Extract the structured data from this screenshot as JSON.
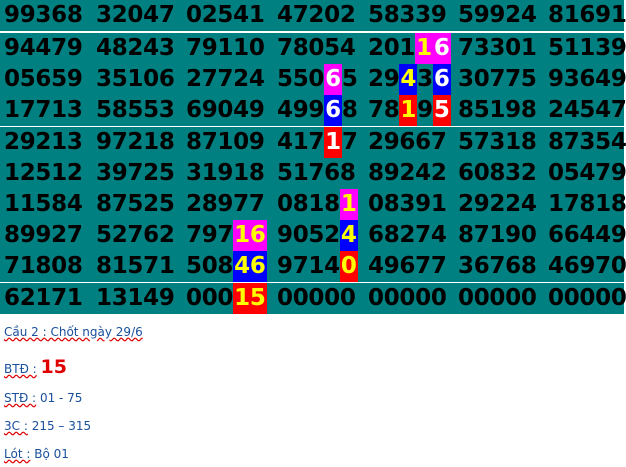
{
  "grid": {
    "rows": [
      [
        "99368",
        "32047",
        "02541",
        "47202",
        "58339",
        "59924",
        "81691"
      ],
      [
        "94479",
        "48243",
        "79110",
        "78054",
        "20116",
        "73301",
        "51139"
      ],
      [
        "05659",
        "35106",
        "27724",
        "55065",
        "29436",
        "30775",
        "93649"
      ],
      [
        "17713",
        "58553",
        "69049",
        "49968",
        "78195",
        "85198",
        "24547"
      ],
      [
        "29213",
        "97218",
        "87109",
        "41717",
        "29667",
        "57318",
        "87354"
      ],
      [
        "12512",
        "39725",
        "31918",
        "51768",
        "89242",
        "60832",
        "05479"
      ],
      [
        "11584",
        "87525",
        "28977",
        "08181",
        "08391",
        "29224",
        "17818"
      ],
      [
        "89927",
        "52762",
        "79716",
        "90524",
        "68274",
        "87190",
        "66449"
      ],
      [
        "71808",
        "81571",
        "50846",
        "97140",
        "49677",
        "36768",
        "46970"
      ],
      [
        "62171",
        "13149",
        "00015",
        "00000",
        "00000",
        "00000",
        "00000"
      ]
    ],
    "highlights": [
      {
        "row": 1,
        "col": 4,
        "start": 3,
        "end": 4,
        "bg": "#ff00ff",
        "fg": "#ffff00"
      },
      {
        "row": 1,
        "col": 4,
        "start": 4,
        "end": 5,
        "bg": "#ff00ff",
        "fg": "#ffffff"
      },
      {
        "row": 2,
        "col": 3,
        "start": 3,
        "end": 4,
        "bg": "#ff00ff",
        "fg": "#ffffff"
      },
      {
        "row": 2,
        "col": 4,
        "start": 2,
        "end": 3,
        "bg": "#0000ff",
        "fg": "#ffff00"
      },
      {
        "row": 2,
        "col": 4,
        "start": 4,
        "end": 5,
        "bg": "#0000ff",
        "fg": "#ffffff"
      },
      {
        "row": 3,
        "col": 3,
        "start": 3,
        "end": 4,
        "bg": "#0000ff",
        "fg": "#ffffff"
      },
      {
        "row": 3,
        "col": 4,
        "start": 2,
        "end": 3,
        "bg": "#ff0000",
        "fg": "#ffff00"
      },
      {
        "row": 3,
        "col": 4,
        "start": 4,
        "end": 5,
        "bg": "#ff0000",
        "fg": "#ffffff"
      },
      {
        "row": 4,
        "col": 3,
        "start": 3,
        "end": 4,
        "bg": "#ff0000",
        "fg": "#ffffff"
      },
      {
        "row": 6,
        "col": 3,
        "start": 4,
        "end": 5,
        "bg": "#ff00ff",
        "fg": "#ffff00"
      },
      {
        "row": 7,
        "col": 2,
        "start": 3,
        "end": 5,
        "bg": "#ff00ff",
        "fg": "#ffff00"
      },
      {
        "row": 7,
        "col": 3,
        "start": 4,
        "end": 5,
        "bg": "#0000ff",
        "fg": "#ffff00"
      },
      {
        "row": 8,
        "col": 2,
        "start": 3,
        "end": 5,
        "bg": "#0000ff",
        "fg": "#ffff00"
      },
      {
        "row": 8,
        "col": 3,
        "start": 4,
        "end": 5,
        "bg": "#ff0000",
        "fg": "#ffff00"
      },
      {
        "row": 9,
        "col": 2,
        "start": 3,
        "end": 5,
        "bg": "#ff0000",
        "fg": "#ffff00"
      }
    ]
  },
  "notes": {
    "cau_label": "Cầu 2 : Chốt ngày 29/6",
    "btd_label": "BTĐ :",
    "btd_value": "15",
    "std_label": "STĐ :",
    "std_value": "01 - 75",
    "c3_label": "3C :",
    "c3_value": "215 – 315",
    "lot_label": "Lót :",
    "lot_value": "Bộ 01"
  }
}
